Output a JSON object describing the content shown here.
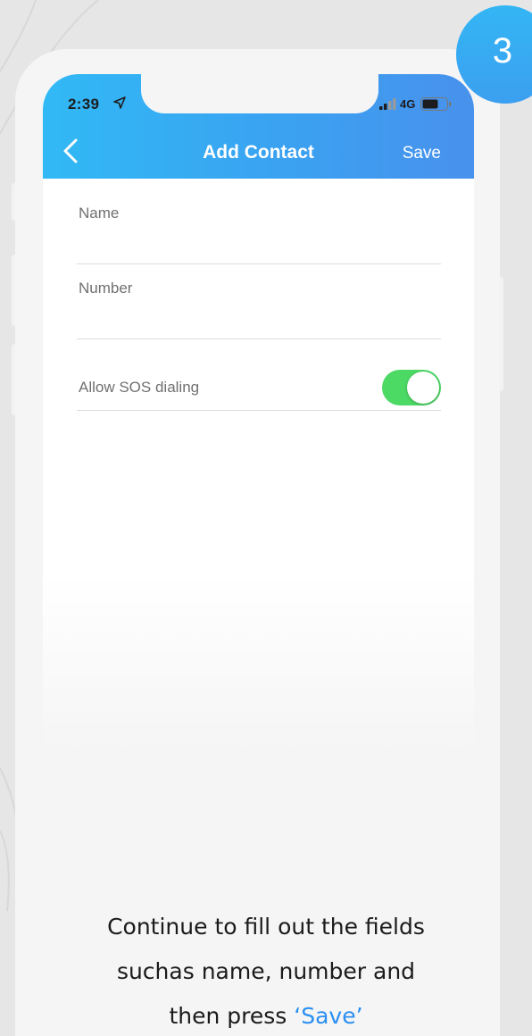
{
  "step": {
    "number": "3"
  },
  "status_bar": {
    "time": "2:39",
    "network": "4G",
    "icons": [
      "location-arrow-icon",
      "signal-bars-icon",
      "battery-icon"
    ]
  },
  "nav_bar": {
    "back_icon": "chevron-left-icon",
    "title": "Add Contact",
    "save_label": "Save"
  },
  "form": {
    "name": {
      "label": "Name",
      "value": ""
    },
    "number": {
      "label": "Number",
      "value": ""
    },
    "sos": {
      "label": "Allow SOS dialing",
      "enabled": true
    }
  },
  "instruction": {
    "line1": "Continue to fill out the fields",
    "line2": "suchas name, number and",
    "line3_prefix": "then press ",
    "line3_highlight": "‘Save’"
  },
  "colors": {
    "header_gradient_start": "#31b9f5",
    "header_gradient_end": "#4891ec",
    "toggle_on": "#4cd964",
    "highlight": "#2b8ff0",
    "background": "#e6e6e7"
  }
}
